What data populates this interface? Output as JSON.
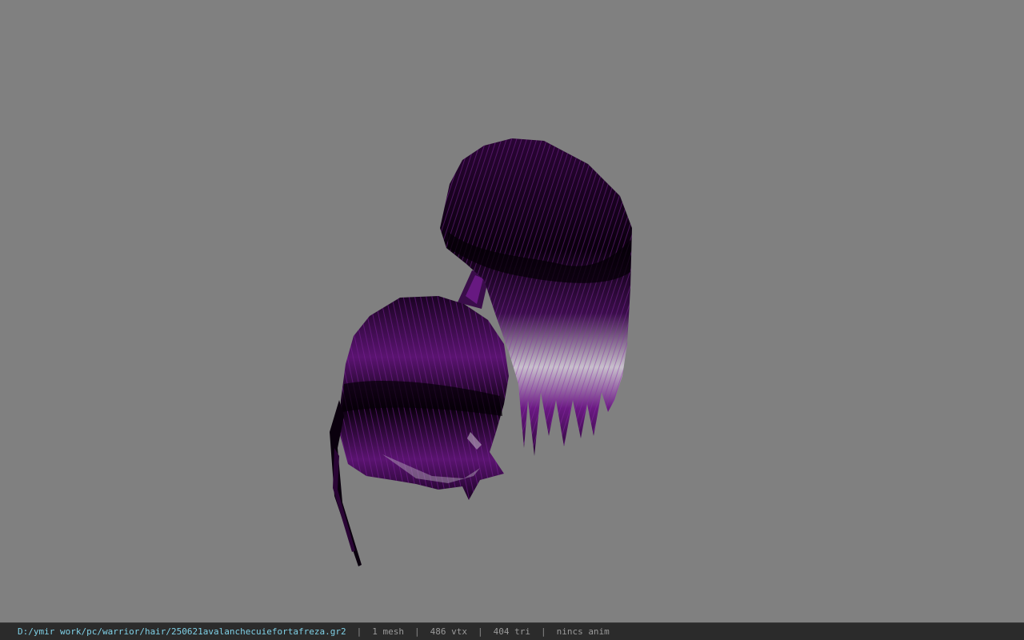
{
  "viewport": {
    "background": "#808080",
    "model": "hair mesh (purple, two hair pieces)"
  },
  "status_bar": {
    "file_path": "D:/ymir work/pc/warrior/hair/250621avalanchecuiefortafreza.gr2",
    "mesh_count": "1 mesh",
    "vertex_count": "486 vtx",
    "triangle_count": "404 tri",
    "anim": "nincs anim",
    "separator": "|",
    "path_color": "#7fd0e6",
    "text_color": "#9a9a9a"
  },
  "colors": {
    "hair_dark": "#0a000d",
    "hair_purple": "#6a1a82",
    "hair_light": "#d8d2dc"
  }
}
